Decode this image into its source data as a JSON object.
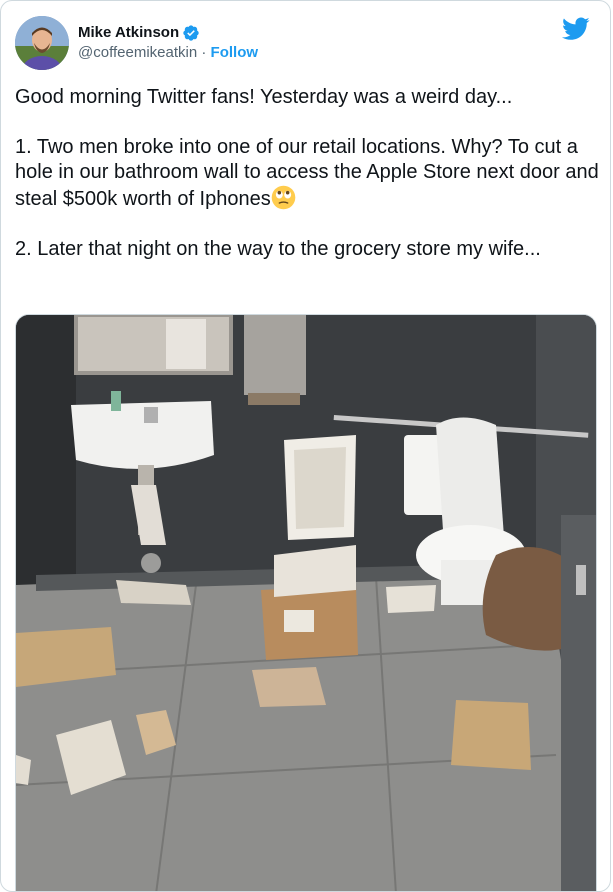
{
  "author": {
    "name": "Mike Atkinson",
    "handle": "@coffeemikeatkin",
    "separator": " · ",
    "follow_label": "Follow",
    "verified": true,
    "avatar_icon": "profile-avatar"
  },
  "brand": {
    "icon": "twitter-bird-icon",
    "color": "#1d9bf0"
  },
  "tweet": {
    "line1": "Good morning Twitter fans! Yesterday was a weird day...",
    "para1": "1. Two men broke into one of our retail locations. Why? To cut a hole in our bathroom wall to access the Apple Store next door and steal $500k worth of Iphones",
    "para1_emoji": "face-with-rolling-eyes",
    "para2": "2. Later that night on the way to the grocery store my wife..."
  },
  "media": {
    "kind": "photo",
    "subject": "bathroom-with-hole-in-wall"
  }
}
